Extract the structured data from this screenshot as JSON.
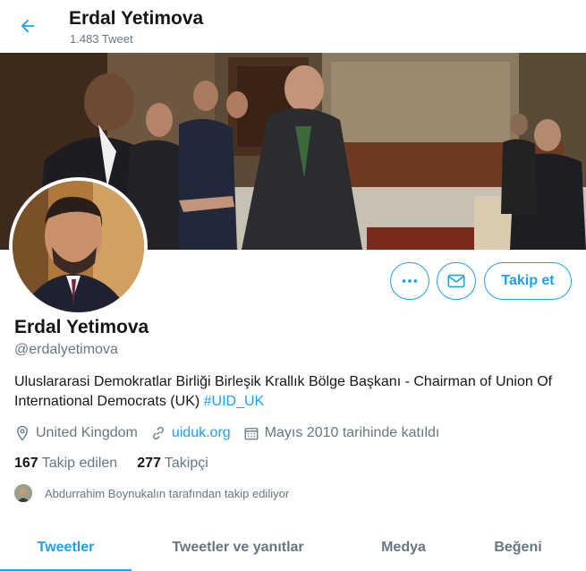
{
  "header": {
    "title": "Erdal Yetimova",
    "tweet_count": "1.483 Tweet"
  },
  "icons": {
    "back": "arrow-left-icon",
    "more": "more-dots-icon",
    "mail": "envelope-icon",
    "location": "location-pin-icon",
    "link": "link-icon",
    "calendar": "calendar-icon"
  },
  "actions": {
    "follow_label": "Takip et"
  },
  "profile": {
    "name": "Erdal Yetimova",
    "handle": "@erdalyetimova",
    "bio_text": "Uluslararasi Demokratlar Birliği Birleşik Krallık Bölge Başkanı - Chairman of Union Of International Democrats (UK) ",
    "bio_hashtag": "#UID_UK",
    "location": "United Kingdom",
    "website": "uiduk.org",
    "joined": "Mayıs 2010 tarihinde katıldı"
  },
  "stats": {
    "following_count": "167",
    "following_label": "Takip edilen",
    "followers_count": "277",
    "followers_label": "Takipçi"
  },
  "followed_by": "Abdurrahim Boynukalın tarafından takip ediliyor",
  "tabs": [
    {
      "label": "Tweetler"
    },
    {
      "label": "Tweetler ve yanıtlar"
    },
    {
      "label": "Medya"
    },
    {
      "label": "Beğeni"
    }
  ],
  "colors": {
    "accent": "#1da1f2",
    "text": "#14171a",
    "muted": "#657786"
  }
}
